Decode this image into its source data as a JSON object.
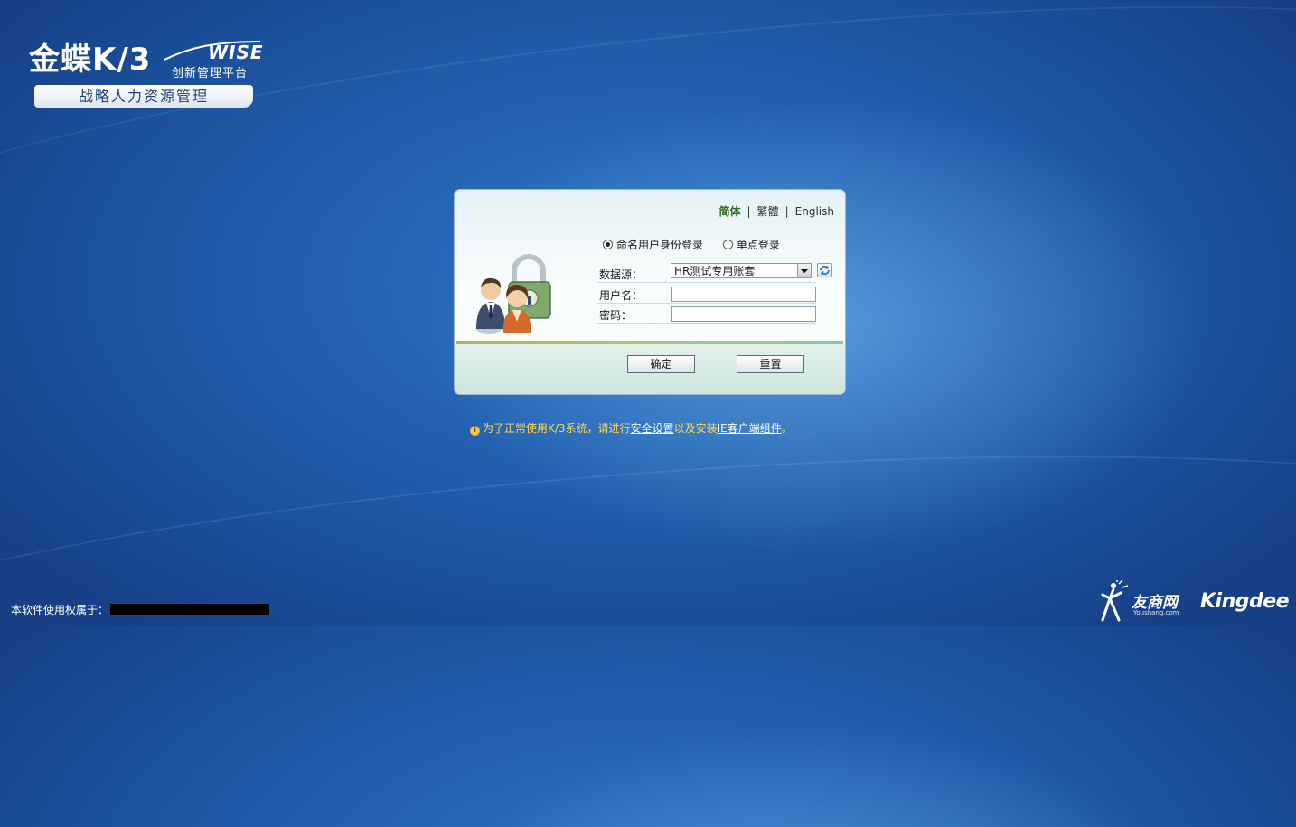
{
  "brand": {
    "logo_text": "金蝶K/3",
    "logo_wise": "WISE",
    "logo_slogan": "创新管理平台",
    "product_name": "战略人力资源管理"
  },
  "login": {
    "languages": [
      "简体",
      "繁體",
      "English"
    ],
    "active_language": "简体",
    "login_modes": [
      {
        "label": "命名用户身份登录",
        "selected": true
      },
      {
        "label": "单点登录",
        "selected": false
      }
    ],
    "datasource_label": "数据源：",
    "datasource_value": "HR测试专用账套",
    "username_label": "用户名：",
    "username_value": "",
    "password_label": "密码：",
    "password_value": "",
    "confirm_label": "确定",
    "reset_label": "重置"
  },
  "notice": {
    "prefix": "为了正常使用K/3系统，请进行",
    "link_security": "安全设置",
    "middle": "以及安装",
    "link_ie": "IE客户端组件",
    "suffix": "。"
  },
  "footer": {
    "owner_label": "本软件使用权属于：",
    "youshang_cn": "友商网",
    "youshang_en": "Youshang.com",
    "kingdee": "Kingdee"
  },
  "colors": {
    "background": "#1f5aa8",
    "notice_text": "#ffd84a",
    "active_language": "#2e6a1c"
  }
}
